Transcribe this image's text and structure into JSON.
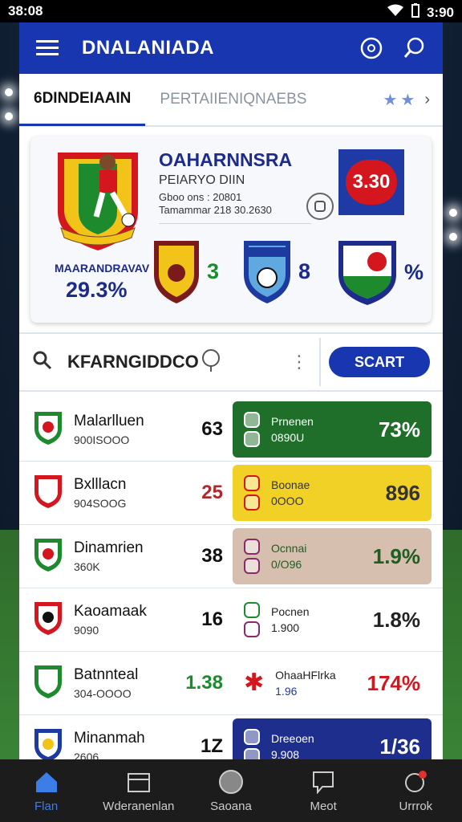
{
  "status": {
    "time": "38:08",
    "clock": "3:90"
  },
  "app": {
    "title": "DNALANIADA"
  },
  "tabs": [
    {
      "label": "6DINDEIAAIN",
      "active": true
    },
    {
      "label": "PERTAIIENIQNAEBS",
      "active": false
    }
  ],
  "featured": {
    "left_label": "MAARANDRAVAV",
    "left_pct": "29.3%",
    "title": "OAHARNNSRA",
    "subtitle": "PEIARYO DIIN",
    "line1": "Gboo ons : 20801",
    "line2": "Tamammar  218  30.2630",
    "score": "3.30",
    "teams": [
      {
        "score": "3",
        "color": "#1e8a2e"
      },
      {
        "score": "8",
        "color": "#1d2b8a"
      },
      {
        "score": "%",
        "color": "#1d2b8a"
      }
    ]
  },
  "search": {
    "query": "KFARNGIDDCO",
    "button": "SCART"
  },
  "rows": [
    {
      "name": "Malarlluen",
      "sub": "900ISOOO",
      "num": "63",
      "num_color": "#111",
      "right": {
        "t1": "Prnenen",
        "t2": "0890U",
        "val": "73%",
        "bg": "#1f6e2a",
        "fg": "#ffffff"
      }
    },
    {
      "name": "Bxlllacn",
      "sub": "904SOOG",
      "num": "25",
      "num_color": "#b0282b",
      "right": {
        "t1": "Boonae",
        "t2": "0OOO",
        "val": "896",
        "bg": "#f2d127",
        "fg": "#333333"
      }
    },
    {
      "name": "Dinamrien",
      "sub": "360K",
      "num": "38",
      "num_color": "#111",
      "right": {
        "t1": "Ocnnai",
        "t2": "0/O96",
        "val": "1.9%",
        "bg": "#d6bfae",
        "fg": "#1e5e23"
      }
    },
    {
      "name": "Kaoamaak",
      "sub": "9090",
      "num": "16",
      "num_color": "#111",
      "right": {
        "t1": "Pocnen",
        "t2": "1.900",
        "val": "1.8%",
        "bg": "#ffffff",
        "fg": "#222222"
      }
    },
    {
      "name": "Batnnteal",
      "sub": "304-OOOO",
      "num": "1.38",
      "num_color": "#1e8a2e",
      "right": {
        "t1": "OhaaHFlrka",
        "t2": "1.96",
        "val": "174%",
        "bg": "#ffffff",
        "fg": "#222222"
      }
    },
    {
      "name": "Minanmah",
      "sub": "2606",
      "num": "1Z",
      "num_color": "#111",
      "right": {
        "t1": "Dreeoen",
        "t2": "9.908",
        "val": "1/36",
        "bg": "#1e2e8c",
        "fg": "#ffffff"
      }
    }
  ],
  "nav": [
    {
      "label": "Flan",
      "icon": "home-icon",
      "active": true
    },
    {
      "label": "Wderanenlan",
      "icon": "calendar-icon",
      "active": false
    },
    {
      "label": "Saoana",
      "icon": "ball-icon",
      "active": false
    },
    {
      "label": "Meot",
      "icon": "chat-icon",
      "active": false
    },
    {
      "label": "Urrrok",
      "icon": "profile-icon",
      "active": false
    }
  ]
}
